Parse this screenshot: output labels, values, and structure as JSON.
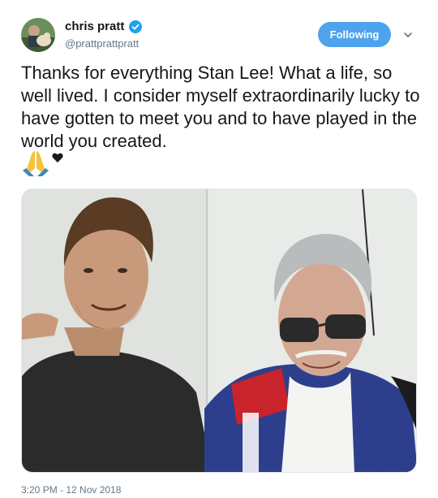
{
  "author": {
    "display_name": "chris pratt",
    "handle": "@prattprattpratt",
    "verified_icon": "verified-badge-icon"
  },
  "follow_button": {
    "label": "Following"
  },
  "tweet": {
    "text": "Thanks for everything Stan Lee! What a life, so well lived. I consider myself extraordinarily lucky to have gotten to meet you and to have played in the world you created.",
    "emojis": [
      "praying-hands-emoji",
      "black-heart-emoji"
    ],
    "timestamp": "3:20 PM - 12 Nov 2018"
  },
  "colors": {
    "follow_button_bg": "#4ea3ec",
    "verified_blue": "#1da1f2",
    "secondary_text": "#657786"
  }
}
